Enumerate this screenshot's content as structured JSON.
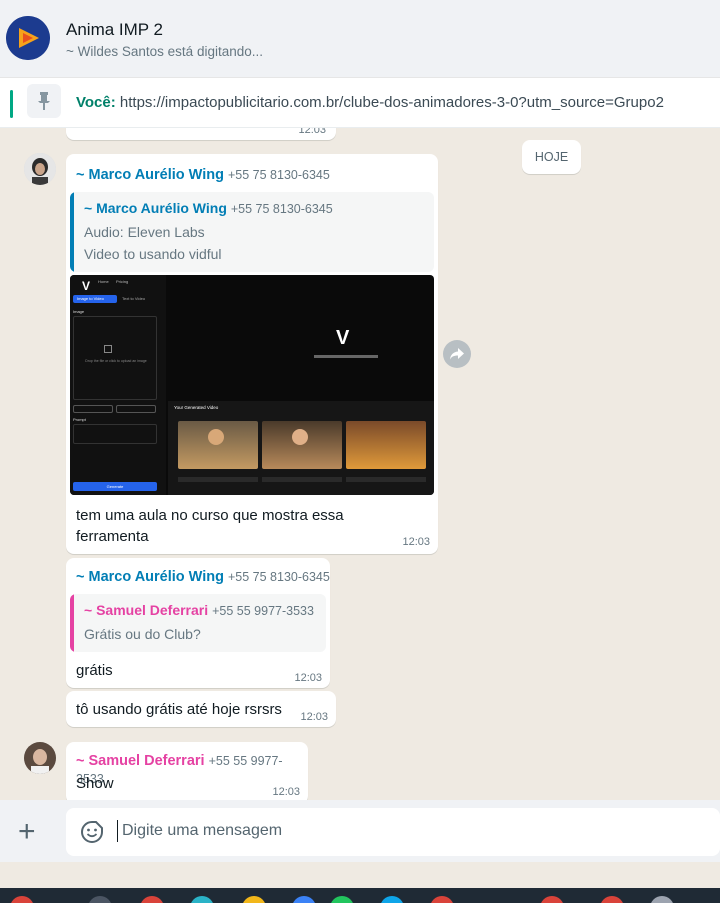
{
  "header": {
    "title": "Anima IMP 2",
    "subtitle": "~ Wildes Santos está digitando..."
  },
  "pinned": {
    "sender": "Você:",
    "text": "https://impactopublicitario.com.br/clube-dos-animadores-3-0?utm_source=Grupo2"
  },
  "date_chip": "HOJE",
  "prev_bubble_time": "12:03",
  "messages": [
    {
      "sender": "~ Marco Aurélio Wing",
      "phone": "+55 75 8130-6345",
      "quote": {
        "sender": "~ Marco Aurélio Wing",
        "phone": "+55 75 8130-6345",
        "line1": "Audio: Eleven Labs",
        "line2": "Video to usando vidful"
      },
      "screenshot": {
        "nav1": "Home",
        "nav2": "Pricing",
        "tab1": "Image to Video",
        "tab2": "Text to Video",
        "section_image": "Image",
        "upload_hint": "Drop the file or click to upload an image",
        "section_prompt": "Prompt",
        "generate": "Generate",
        "panel_title": "Your Generated Video"
      },
      "text": "tem uma aula no curso que mostra essa ferramenta",
      "time": "12:03"
    },
    {
      "sender": "~ Marco Aurélio Wing",
      "phone": "+55 75 8130-6345",
      "quote": {
        "sender": "~ Samuel Deferrari",
        "phone": "+55 55 9977-3533",
        "line1": "Grátis ou do Club?"
      },
      "text": "grátis",
      "time": "12:03"
    },
    {
      "text": "tô usando grátis até hoje rsrsrs",
      "time": "12:03"
    },
    {
      "sender": "~ Samuel Deferrari",
      "phone": "+55 55 9977-3533",
      "text": "Show",
      "time": "12:03"
    }
  ],
  "composer": {
    "placeholder": "Digite uma mensagem"
  },
  "colors": {
    "accent": "#00a884",
    "sender_blue": "#027eb5",
    "sender_pink": "#e542a3",
    "chat_bg": "#efeae2"
  },
  "icons": [
    "group-avatar-icon",
    "pin-icon",
    "forward-icon",
    "plus-icon",
    "emoji-icon"
  ]
}
